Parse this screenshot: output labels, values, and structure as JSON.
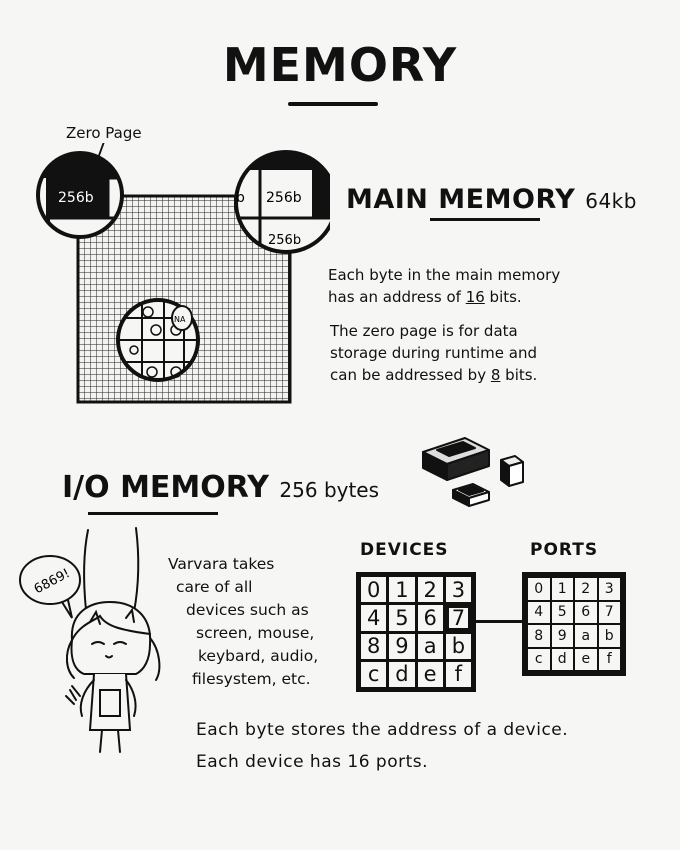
{
  "title": "MEMORY",
  "zero_page_label": "Zero Page",
  "memory_grid": {
    "left_zoom_label": "256b",
    "right_zoom_labels": [
      "b",
      "256b",
      "256b"
    ],
    "center_zoom_label": "NA"
  },
  "main_memory": {
    "title": "MAIN MEMORY",
    "size": "64kb",
    "desc_byte": [
      "Each byte in the main memory",
      "has an address of ",
      "16",
      " bits."
    ],
    "desc_zero": [
      "The zero page is for data",
      "storage during runtime and",
      "can be addressed by ",
      "8",
      " bits."
    ]
  },
  "io_memory": {
    "title": "I/O MEMORY",
    "size": "256 bytes"
  },
  "devices": {
    "label": "DEVICES",
    "cells": [
      "0",
      "1",
      "2",
      "3",
      "4",
      "5",
      "6",
      "7",
      "8",
      "9",
      "a",
      "b",
      "c",
      "d",
      "e",
      "f"
    ],
    "highlighted": "7"
  },
  "ports": {
    "label": "PORTS",
    "cells": [
      "0",
      "1",
      "2",
      "3",
      "4",
      "5",
      "6",
      "7",
      "8",
      "9",
      "a",
      "b",
      "c",
      "d",
      "e",
      "f"
    ]
  },
  "varvara_text": [
    "Varvara takes",
    "care of all",
    "devices such as",
    "screen, mouse,",
    "keybard, audio,",
    "filesystem, etc."
  ],
  "speech_bubble": "6869!",
  "bottom_lines": [
    "Each byte stores the address of a device.",
    "Each device has 16 ports."
  ]
}
